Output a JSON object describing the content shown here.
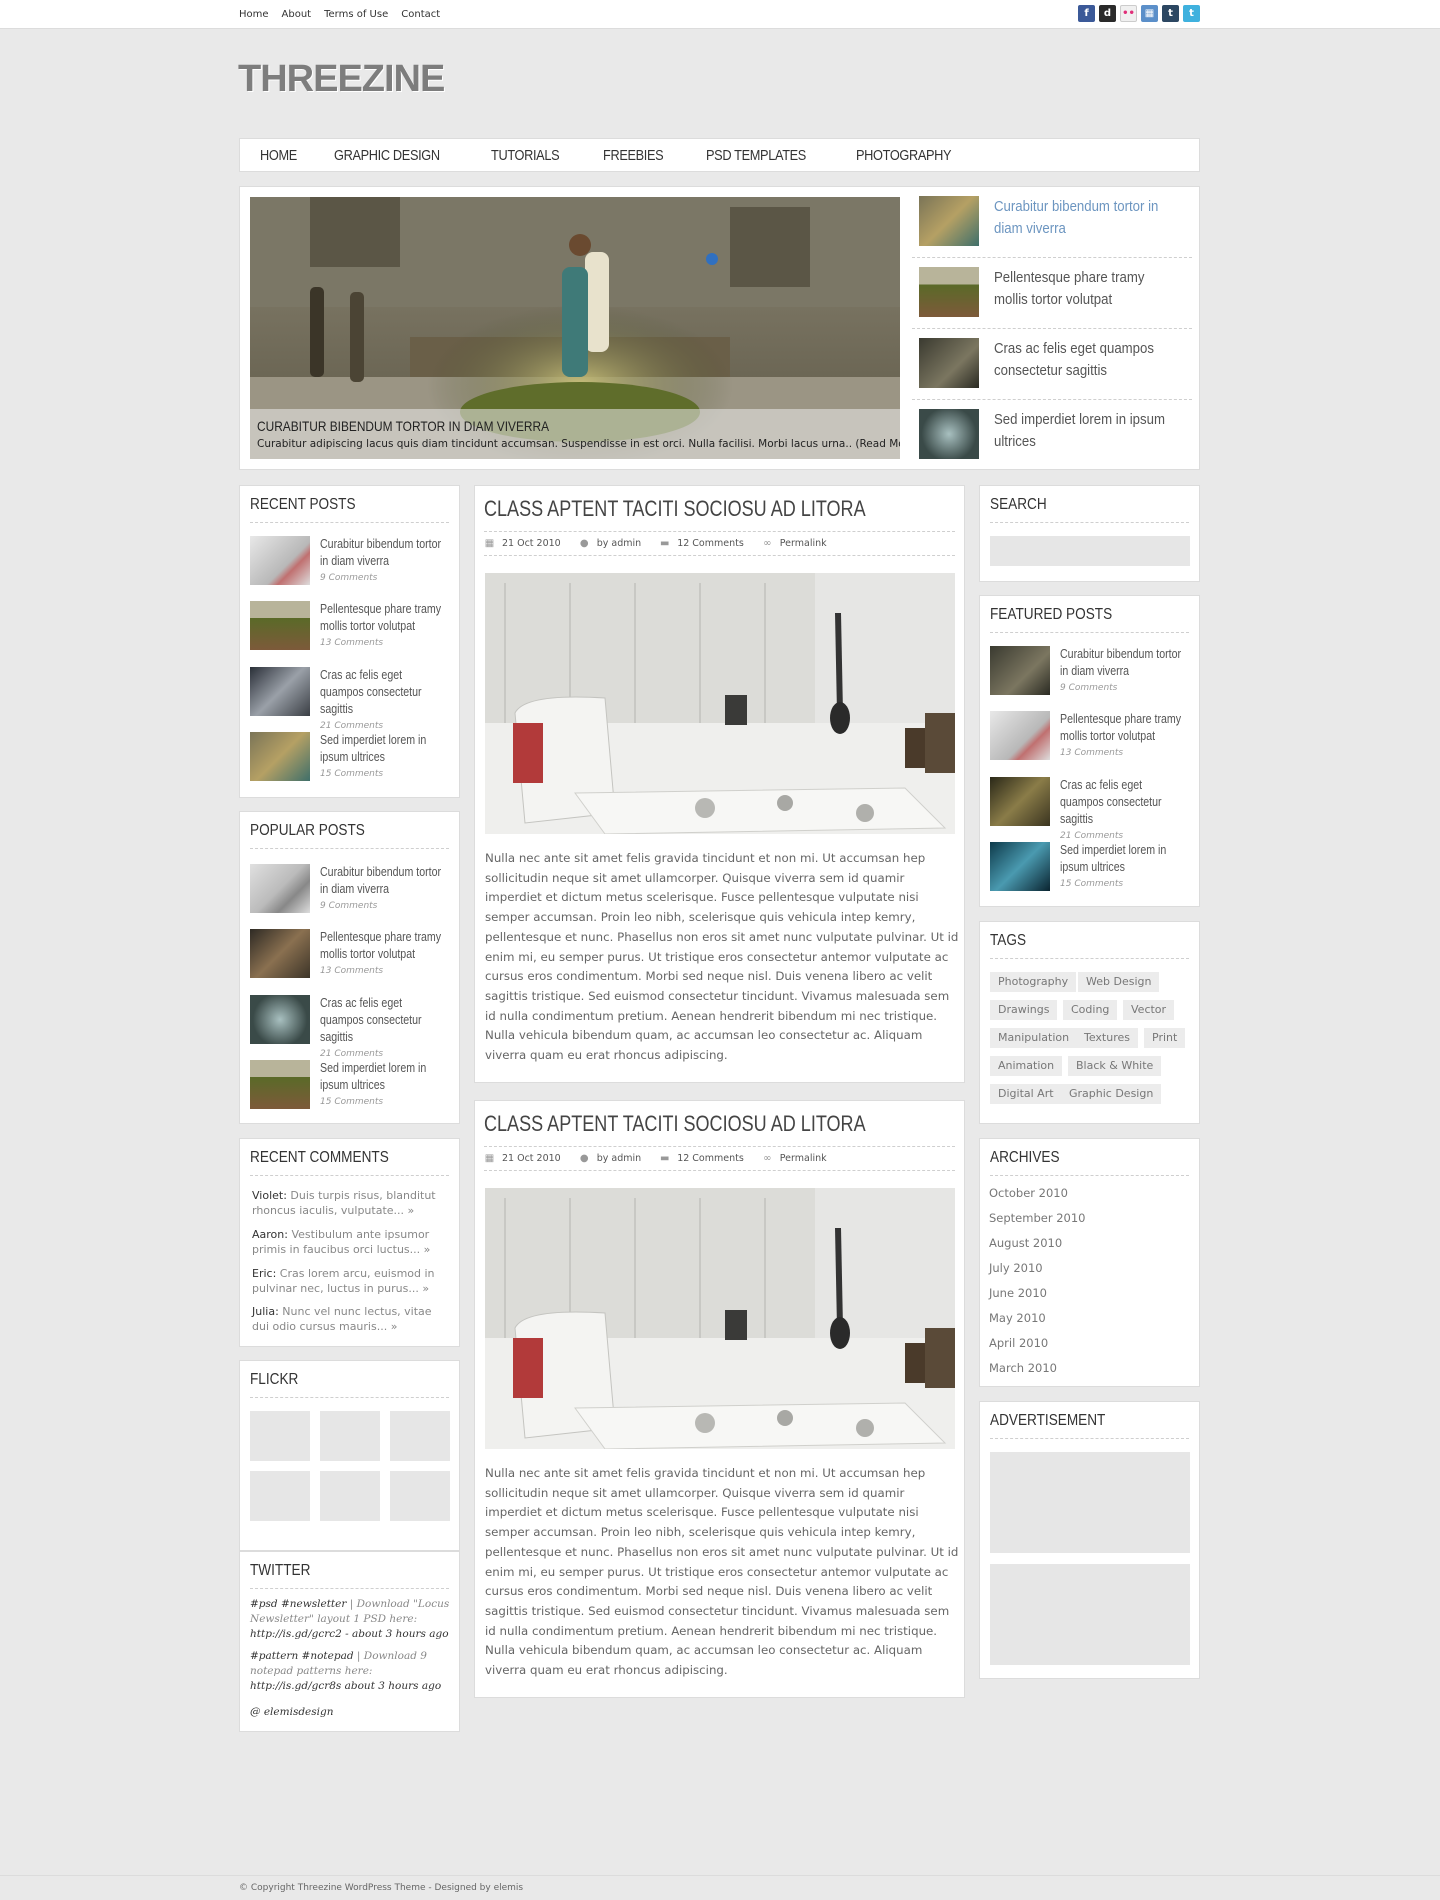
{
  "topnav": [
    "Home",
    "About",
    "Terms of Use",
    "Contact"
  ],
  "social": [
    {
      "name": "facebook-icon",
      "glyph": "f",
      "color": "#3b5998"
    },
    {
      "name": "delicious-icon",
      "glyph": "d",
      "color": "#2a2a2a"
    },
    {
      "name": "flickr-icon",
      "glyph": "••",
      "color": "#f0f0f0"
    },
    {
      "name": "grid-icon",
      "glyph": "▦",
      "color": "#5b8fc9"
    },
    {
      "name": "tumblr-icon",
      "glyph": "t",
      "color": "#2c4762"
    },
    {
      "name": "twitter-icon",
      "glyph": "t",
      "color": "#3fb1de"
    }
  ],
  "logo": "THREEZINE",
  "nav": [
    "HOME",
    "GRAPHIC DESIGN",
    "TUTORIALS",
    "FREEBIES",
    "PSD TEMPLATES",
    "PHOTOGRAPHY"
  ],
  "slider": {
    "title": "CURABITUR BIBENDUM TORTOR IN DIAM VIVERRA",
    "text": "Curabitur adipiscing lacus quis diam tincidunt accumsan. Suspendisse in est orci. Nulla facilisi. Morbi lacus urna.. (Read More)",
    "items": [
      "Curabitur bibendum tortor in diam viverra",
      "Pellentesque phare tramy mollis tortor volutpat",
      "Cras ac felis eget quampos consectetur sagittis",
      "Sed imperdiet lorem in ipsum ultrices"
    ]
  },
  "recent_posts": {
    "title": "RECENT POSTS",
    "items": [
      {
        "title": "Curabitur bibendum tortor in diam viverra",
        "comments": "9 Comments"
      },
      {
        "title": "Pellentesque phare tramy mollis tortor volutpat",
        "comments": "13 Comments"
      },
      {
        "title": "Cras ac felis eget quampos consectetur sagittis",
        "comments": "21 Comments"
      },
      {
        "title": "Sed imperdiet lorem in ipsum ultrices",
        "comments": "15 Comments"
      }
    ]
  },
  "popular_posts": {
    "title": "POPULAR POSTS",
    "items": [
      {
        "title": "Curabitur bibendum tortor in diam viverra",
        "comments": "9 Comments"
      },
      {
        "title": "Pellentesque phare tramy mollis tortor volutpat",
        "comments": "13 Comments"
      },
      {
        "title": "Cras ac felis eget quampos consectetur sagittis",
        "comments": "21 Comments"
      },
      {
        "title": "Sed imperdiet lorem in ipsum ultrices",
        "comments": "15 Comments"
      }
    ]
  },
  "recent_comments": {
    "title": "RECENT COMMENTS",
    "items": [
      {
        "author": "Violet:",
        "text": "Duis turpis risus, blanditut rhoncus iaculis, vulputate... »"
      },
      {
        "author": "Aaron:",
        "text": "Vestibulum ante ipsumor primis in faucibus orci luctus... »"
      },
      {
        "author": "Eric:",
        "text": "Cras lorem arcu, euismod in pulvinar nec, luctus in purus... »"
      },
      {
        "author": "Julia:",
        "text": "Nunc vel nunc lectus, vitae dui odio cursus mauris... »"
      }
    ]
  },
  "flickr": {
    "title": "FLICKR"
  },
  "twitter": {
    "title": "TWITTER",
    "tweets": [
      {
        "tags": "#psd #newsletter",
        "text": " | Download \"Locus Newsletter\" layout 1 PSD here: ",
        "link": "http://is.gd/gcrc2 - about 3 hours ago"
      },
      {
        "tags": "#pattern #notepad",
        "text": " | Download 9 notepad patterns here: ",
        "link": "http://is.gd/gcr8s about 3 hours ago"
      }
    ],
    "handle": "@ elemisdesign"
  },
  "posts": [
    {
      "title": "CLASS APTENT TACITI SOCIOSU AD LITORA",
      "date": "21 Oct 2010",
      "author": "by admin",
      "comments": "12 Comments",
      "permalink": "Permalink",
      "body": "Nulla nec ante sit amet felis gravida tincidunt et non mi. Ut accumsan hep sollicitudin neque sit amet ullamcorper. Quisque viverra sem id quamir imperdiet et dictum metus scelerisque. Fusce pellentesque vulputate nisi semper accumsan. Proin leo nibh, scelerisque quis vehicula intep kemry, pellentesque et nunc. Phasellus non eros sit amet nunc vulputate pulvinar. Ut id enim mi, eu semper purus. Ut tristique eros consectetur antemor vulputate ac cursus eros condimentum. Morbi sed neque nisl. Duis venena libero ac velit sagittis tristique. Sed euismod consectetur tincidunt. Vivamus malesuada sem id nulla condimentum pretium. Aenean hendrerit bibendum mi nec tristique. Nulla vehicula bibendum quam, ac accumsan leo consectetur ac. Aliquam viverra quam eu erat rhoncus adipiscing."
    },
    {
      "title": "CLASS APTENT TACITI SOCIOSU AD LITORA",
      "date": "21 Oct 2010",
      "author": "by admin",
      "comments": "12 Comments",
      "permalink": "Permalink",
      "body": "Nulla nec ante sit amet felis gravida tincidunt et non mi. Ut accumsan hep sollicitudin neque sit amet ullamcorper. Quisque viverra sem id quamir imperdiet et dictum metus scelerisque. Fusce pellentesque vulputate nisi semper accumsan. Proin leo nibh, scelerisque quis vehicula intep kemry, pellentesque et nunc. Phasellus non eros sit amet nunc vulputate pulvinar. Ut id enim mi, eu semper purus. Ut tristique eros consectetur antemor vulputate ac cursus eros condimentum. Morbi sed neque nisl. Duis venena libero ac velit sagittis tristique. Sed euismod consectetur tincidunt. Vivamus malesuada sem id nulla condimentum pretium. Aenean hendrerit bibendum mi nec tristique. Nulla vehicula bibendum quam, ac accumsan leo consectetur ac. Aliquam viverra quam eu erat rhoncus adipiscing."
    }
  ],
  "search": {
    "title": "SEARCH",
    "placeholder": ""
  },
  "featured_posts": {
    "title": "FEATURED POSTS",
    "items": [
      {
        "title": "Curabitur bibendum tortor in diam viverra",
        "comments": "9 Comments"
      },
      {
        "title": "Pellentesque phare tramy mollis tortor volutpat",
        "comments": "13 Comments"
      },
      {
        "title": "Cras ac felis eget quampos consectetur sagittis",
        "comments": "21 Comments"
      },
      {
        "title": "Sed imperdiet lorem in ipsum ultrices",
        "comments": "15 Comments"
      }
    ]
  },
  "tags": {
    "title": "TAGS",
    "items": [
      "Photography",
      "Web Design",
      "Drawings",
      "Coding",
      "Vector",
      "Manipulation",
      "Textures",
      "Print",
      "Animation",
      "Black & White",
      "Digital Art",
      "Graphic Design"
    ]
  },
  "archives": {
    "title": "ARCHIVES",
    "items": [
      "October 2010",
      "September 2010",
      "August 2010",
      "July 2010",
      "June 2010",
      "May 2010",
      "April 2010",
      "March 2010"
    ]
  },
  "advertisement": {
    "title": "ADVERTISEMENT"
  },
  "footer": "© Copyright Threezine WordPress Theme - Designed by elemis"
}
